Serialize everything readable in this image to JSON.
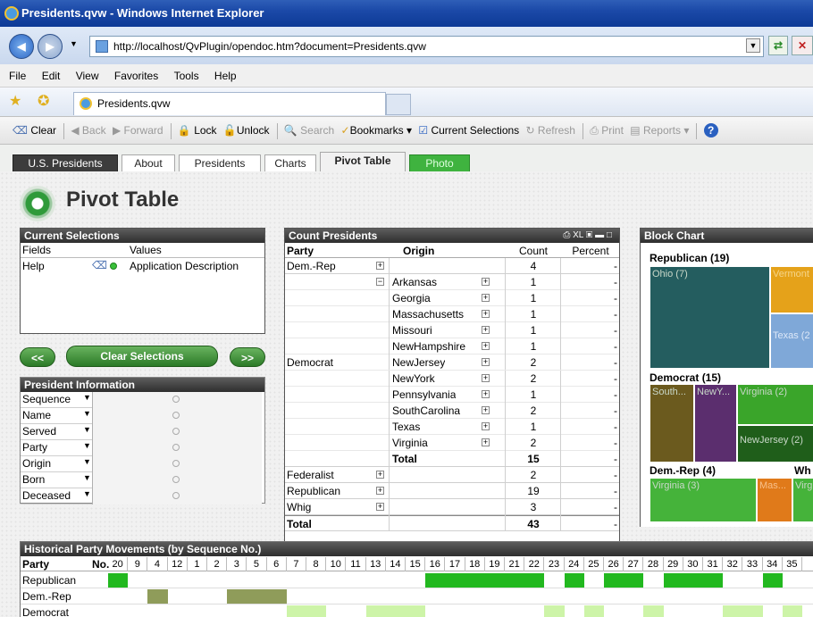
{
  "window": {
    "title": "Presidents.qvw - Windows Internet Explorer"
  },
  "address": {
    "url": "http://localhost/QvPlugin/opendoc.htm?document=Presidents.qvw"
  },
  "menu": [
    "File",
    "Edit",
    "View",
    "Favorites",
    "Tools",
    "Help"
  ],
  "browser_tab": {
    "label": "Presidents.qvw"
  },
  "qv_toolbar": {
    "clear": "Clear",
    "back": "Back",
    "forward": "Forward",
    "lock": "Lock",
    "unlock": "Unlock",
    "search": "Search",
    "bookmarks": "Bookmarks",
    "current_selections": "Current Selections",
    "refresh": "Refresh",
    "print": "Print",
    "reports": "Reports"
  },
  "sheet_tabs": [
    "U.S. Presidents",
    "About",
    "Presidents",
    "Charts",
    "Pivot Table",
    "Photo"
  ],
  "active_tab": "Pivot Table",
  "page_title": "Pivot Table",
  "current_selections": {
    "caption": "Current Selections",
    "col_fields": "Fields",
    "col_values": "Values",
    "rows": [
      {
        "field": "Help",
        "value": "Application Description"
      }
    ]
  },
  "buttons": {
    "prev": "<<",
    "clear": "Clear Selections",
    "next": ">>"
  },
  "president_info": {
    "caption": "President Information",
    "fields": [
      "Sequence",
      "Name",
      "Served",
      "Party",
      "Origin",
      "Born",
      "Deceased"
    ]
  },
  "pivot": {
    "caption": "Count Presidents",
    "headers": {
      "party": "Party",
      "origin": "Origin",
      "count": "Count",
      "percent": "Percent"
    },
    "rows": [
      {
        "party": "Dem.-Rep",
        "origin": "",
        "count": "4",
        "percent": "-",
        "party_toggle": "+"
      },
      {
        "party": "",
        "origin": "Arkansas",
        "count": "1",
        "percent": "-"
      },
      {
        "party": "",
        "origin": "Georgia",
        "count": "1",
        "percent": "-"
      },
      {
        "party": "",
        "origin": "Massachusetts",
        "count": "1",
        "percent": "-"
      },
      {
        "party": "",
        "origin": "Missouri",
        "count": "1",
        "percent": "-"
      },
      {
        "party": "",
        "origin": "NewHampshire",
        "count": "1",
        "percent": "-"
      },
      {
        "party": "Democrat",
        "origin": "NewJersey",
        "count": "2",
        "percent": "-"
      },
      {
        "party": "",
        "origin": "NewYork",
        "count": "2",
        "percent": "-"
      },
      {
        "party": "",
        "origin": "Pennsylvania",
        "count": "1",
        "percent": "-"
      },
      {
        "party": "",
        "origin": "SouthCarolina",
        "count": "2",
        "percent": "-"
      },
      {
        "party": "",
        "origin": "Texas",
        "count": "1",
        "percent": "-"
      },
      {
        "party": "",
        "origin": "Virginia",
        "count": "2",
        "percent": "-"
      },
      {
        "party": "",
        "origin": "Total",
        "count": "15",
        "percent": "-"
      },
      {
        "party": "Federalist",
        "origin": "",
        "count": "2",
        "percent": "-"
      },
      {
        "party": "Republican",
        "origin": "",
        "count": "19",
        "percent": "-"
      },
      {
        "party": "Whig",
        "origin": "",
        "count": "3",
        "percent": "-"
      },
      {
        "party": "Total",
        "origin": "",
        "count": "43",
        "percent": "-"
      }
    ]
  },
  "block_chart": {
    "caption": "Block Chart",
    "groups": [
      {
        "label": "Republican (19)",
        "blocks": [
          "Ohio (7)",
          "Vermont",
          "Texas (2"
        ]
      },
      {
        "label": "Democrat (15)",
        "blocks": [
          "South...",
          "NewY...",
          "Virginia (2)",
          "NewJersey (2)"
        ]
      },
      {
        "label": "Dem.-Rep (4)",
        "blocks": [
          "Virginia (3)",
          "Mas...",
          "Virg"
        ]
      },
      {
        "label": "Wh",
        "blocks": []
      }
    ],
    "colors": {
      "republican": "#245d5f",
      "rep_secondary": "#e5a21a",
      "rep_tertiary": "#7fa8d8",
      "dem_primary": "#6b5a1e",
      "dem_purple": "#5b2e6e",
      "dem_green": "#3aa52a",
      "dem_dark": "#1f5e1a",
      "demrep_green": "#45b33a",
      "demrep_orange": "#e07a1a"
    }
  },
  "historical": {
    "caption": "Historical Party Movements (by Sequence No.)",
    "col_party": "Party",
    "col_no": "No.",
    "sequence": [
      "20",
      "9",
      "4",
      "12",
      "1",
      "2",
      "3",
      "5",
      "6",
      "7",
      "8",
      "10",
      "11",
      "13",
      "14",
      "15",
      "16",
      "17",
      "18",
      "19",
      "21",
      "22",
      "23",
      "24",
      "25",
      "26",
      "27",
      "28",
      "29",
      "30",
      "31",
      "32",
      "33",
      "34",
      "35"
    ],
    "parties": [
      "Republican",
      "Dem.-Rep",
      "Democrat"
    ],
    "colors": {
      "republican": "#22b81f",
      "demrep": "#8f9c5a",
      "democrat": "#cdf4a8"
    }
  }
}
